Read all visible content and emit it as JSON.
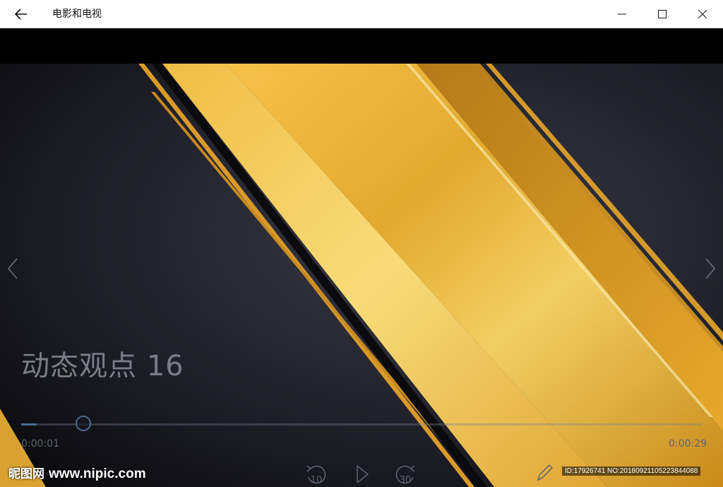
{
  "app": {
    "title": "电影和电视"
  },
  "window": {
    "back": "back-arrow",
    "minimize": "minimize",
    "maximize": "maximize",
    "close": "close"
  },
  "video": {
    "caption": "动态观点 16",
    "progress": 0.023,
    "elapsed": "0:00:01",
    "duration": "0:00:29"
  },
  "controls": {
    "skip_back_label": "10",
    "skip_forward_label": "30"
  },
  "watermark": {
    "site_name": "昵图网",
    "site_url": "www.nipic.com",
    "id_text": "ID:17926741 NO:20180921105223844088"
  },
  "colors": {
    "accent": "#4d6c94",
    "gold": "#e8b23a",
    "background": "#1a1a22"
  }
}
